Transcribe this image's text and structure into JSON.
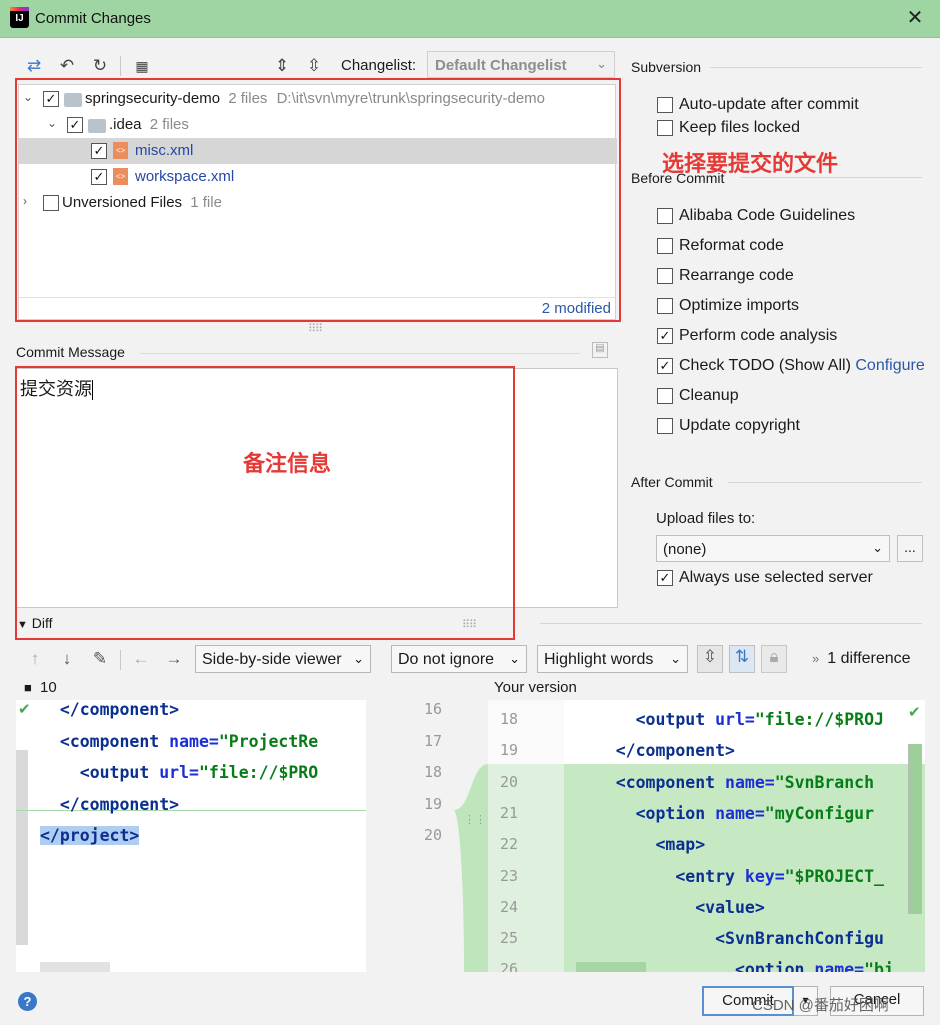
{
  "window": {
    "title": "Commit Changes",
    "app_icon": "IJ"
  },
  "toolbar": {
    "changelist_label": "Changelist:",
    "changelist_value": "Default Changelist"
  },
  "tree": {
    "rows": [
      {
        "name": "springsecurity-demo",
        "count": "2 files",
        "path": "D:\\it\\svn\\myre\\trunk\\springsecurity-demo"
      },
      {
        "name": ".idea",
        "count": "2 files"
      },
      {
        "name": "misc.xml"
      },
      {
        "name": "workspace.xml"
      },
      {
        "name": "Unversioned Files",
        "count": "1 file"
      }
    ],
    "status": "2 modified"
  },
  "annotations": {
    "select_files": "选择要提交的文件",
    "remark": "备注信息"
  },
  "commit_message": {
    "label": "Commit Message",
    "value": "提交资源"
  },
  "subversion": {
    "title": "Subversion",
    "options": [
      {
        "label": "Auto-update after commit",
        "checked": false
      },
      {
        "label": "Keep files locked",
        "checked": false
      }
    ]
  },
  "before_commit": {
    "title": "Before Commit",
    "options": [
      {
        "label": "Alibaba Code Guidelines",
        "checked": false
      },
      {
        "label": "Reformat code",
        "checked": false
      },
      {
        "label": "Rearrange code",
        "checked": false
      },
      {
        "label": "Optimize imports",
        "checked": false
      },
      {
        "label": "Perform code analysis",
        "checked": true
      },
      {
        "label": "Check TODO (Show All)",
        "checked": true,
        "link": "Configure"
      },
      {
        "label": "Cleanup",
        "checked": false
      },
      {
        "label": "Update copyright",
        "checked": false
      }
    ]
  },
  "after_commit": {
    "title": "After Commit",
    "upload_label": "Upload files to:",
    "upload_value": "(none)",
    "more": "...",
    "always_use": "Always use selected server"
  },
  "diff": {
    "title": "Diff",
    "viewer": "Side-by-side viewer",
    "ignore": "Do not ignore",
    "highlight": "Highlight words",
    "difference_count": "1 difference",
    "left_version": "10",
    "right_version": "Your version",
    "left_lines": [
      {
        "indent": "  ",
        "open": "</",
        "tag": "component",
        "close": ">"
      },
      {
        "indent": "  ",
        "open": "<",
        "tag": "component",
        "attr": " name=",
        "value": "\"ProjectRe"
      },
      {
        "indent": "    ",
        "open": "<",
        "tag": "output",
        "attr": " url=",
        "value": "\"file://$PRO"
      },
      {
        "indent": "  ",
        "open": "</",
        "tag": "component",
        "close": ">"
      },
      {
        "indent": "",
        "open": "</",
        "tag": "project",
        "close": ">"
      }
    ],
    "gutter_left_numbers": [
      "16",
      "17",
      "18",
      "19",
      "20"
    ],
    "gutter_right_numbers": [
      "18",
      "19",
      "20",
      "21",
      "22",
      "23",
      "24",
      "25",
      "26"
    ],
    "right_lines": [
      {
        "indent": "      ",
        "open": "<",
        "tag": "output",
        "attr": " url=",
        "value": "\"file://$PROJ"
      },
      {
        "indent": "    ",
        "open": "</",
        "tag": "component",
        "close": ">"
      },
      {
        "indent": "    ",
        "open": "<",
        "tag": "component",
        "attr": " name=",
        "value": "\"SvnBranch"
      },
      {
        "indent": "      ",
        "open": "<",
        "tag": "option",
        "attr": " name=",
        "value": "\"myConfigur"
      },
      {
        "indent": "        ",
        "open": "<",
        "tag": "map",
        "close": ">"
      },
      {
        "indent": "          ",
        "open": "<",
        "tag": "entry",
        "attr": " key=",
        "value": "\"$PROJECT_"
      },
      {
        "indent": "            ",
        "open": "<",
        "tag": "value",
        "close": ">"
      },
      {
        "indent": "              ",
        "open": "<",
        "tag": "SvnBranchConfigu"
      },
      {
        "indent": "                ",
        "open": "<",
        "tag": "option",
        "attr": " name=",
        "value": "\"bi"
      }
    ]
  },
  "footer": {
    "help": "?",
    "commit": "Commit",
    "cancel": "Cancel",
    "watermark": "CSDN @番茄好困啊"
  }
}
